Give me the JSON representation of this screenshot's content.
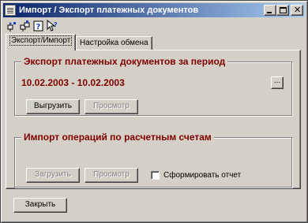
{
  "window": {
    "title": "Импорт / Экспорт платежных документов"
  },
  "toolbar": {
    "icons": [
      "pin-icon",
      "pin-all-icon",
      "help-icon",
      "context-help-icon"
    ]
  },
  "tabs": [
    {
      "label": "Экспорт/Импорт",
      "active": true
    },
    {
      "label": "Настройка обмена",
      "active": false
    }
  ],
  "export": {
    "title": "Экспорт платежных документов за период",
    "period": "10.02.2003 - 10.02.2003",
    "select_period_label": "...",
    "unload_label": "Выгрузить",
    "view_label": "Просмотр"
  },
  "import": {
    "title": "Импорт операций по расчетным счетам",
    "load_label": "Загрузить",
    "view_label": "Просмотр",
    "report_checkbox_label": "Сформировать отчет",
    "report_checked": false
  },
  "close_label": "Закрыть"
}
